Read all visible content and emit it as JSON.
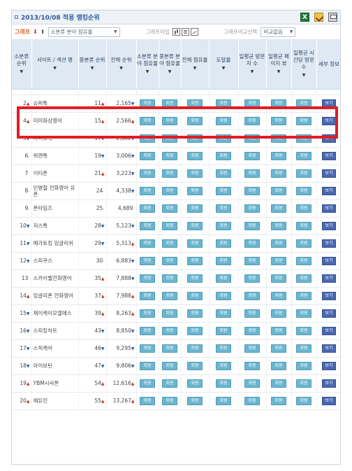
{
  "header": {
    "title": "2013/10/08 적용 랭킹순위"
  },
  "toolbar": {
    "graph_label": "그래프",
    "category_select": "소분류 분야 점유율",
    "graph_type_label": "그래프타입",
    "compare_label": "그래프비교선택",
    "compare_select": "비교없음"
  },
  "columns": [
    {
      "label": "소분류 순위"
    },
    {
      "label": "사이트 / 섹션 명"
    },
    {
      "label": "중분류 순위"
    },
    {
      "label": "전체 순위"
    },
    {
      "label": "소분류 분야 점유율"
    },
    {
      "label": "중분류 분야 점유율"
    },
    {
      "label": "전체 점유율"
    },
    {
      "label": "도달율"
    },
    {
      "label": "일평균 방문자 수"
    },
    {
      "label": "일평균 페이지 뷰"
    },
    {
      "label": "일평균 시간당 방문수"
    },
    {
      "label": "세부 정보"
    }
  ],
  "rows": [
    {
      "rank": "2",
      "rank_change": "up",
      "name": "슈퍼톡",
      "mid_rank": "11",
      "mid_change": "up",
      "total_rank": "2,165",
      "total_change": "down"
    },
    {
      "rank": "4",
      "rank_change": "up",
      "name": "미미화상영어",
      "mid_rank": "15",
      "mid_change": "up",
      "total_rank": "2,566",
      "total_change": "up"
    },
    {
      "rank": "5",
      "rank_change": "down",
      "name": "아이고톡",
      "mid_rank": "17",
      "mid_change": "down",
      "total_rank": "2,682",
      "total_change": "down"
    },
    {
      "rank": "6",
      "rank_change": "same",
      "name": "위캔톡",
      "mid_rank": "19",
      "mid_change": "down",
      "total_rank": "3,006",
      "total_change": "down"
    },
    {
      "rank": "7",
      "rank_change": "same",
      "name": "이티폰",
      "mid_rank": "21",
      "mid_change": "up",
      "total_rank": "3,223",
      "total_change": "down"
    },
    {
      "rank": "8",
      "rank_change": "same",
      "name": "민병철 전화영어 유폰",
      "mid_rank": "24",
      "mid_change": "same",
      "total_rank": "4,338",
      "total_change": "down"
    },
    {
      "rank": "9",
      "rank_change": "same",
      "name": "폰타임즈",
      "mid_rank": "25",
      "mid_change": "same",
      "total_rank": "4,689",
      "total_change": "same"
    },
    {
      "rank": "10",
      "rank_change": "down",
      "name": "저스톡",
      "mid_rank": "28",
      "mid_change": "down",
      "total_rank": "5,123",
      "total_change": "down"
    },
    {
      "rank": "11",
      "rank_change": "down",
      "name": "메가토킹 잉글리쉬",
      "mid_rank": "29",
      "mid_change": "down",
      "total_rank": "5,313",
      "total_change": "up"
    },
    {
      "rank": "12",
      "rank_change": "down",
      "name": "스피쿠스",
      "mid_rank": "30",
      "mid_change": "same",
      "total_rank": "6,883",
      "total_change": "down"
    },
    {
      "rank": "13",
      "rank_change": "same",
      "name": "스카이벨전화영어",
      "mid_rank": "35",
      "mid_change": "up",
      "total_rank": "7,888",
      "total_change": "down"
    },
    {
      "rank": "14",
      "rank_change": "up",
      "name": "잉글리폰 전화영어",
      "mid_rank": "37",
      "mid_change": "up",
      "total_rank": "7,988",
      "total_change": "up"
    },
    {
      "rank": "15",
      "rank_change": "down",
      "name": "제이케이오엘에스",
      "mid_rank": "39",
      "mid_change": "up",
      "total_rank": "8,263",
      "total_change": "up"
    },
    {
      "rank": "16",
      "rank_change": "down",
      "name": "스피킹차트",
      "mid_rank": "43",
      "mid_change": "down",
      "total_rank": "8,850",
      "total_change": "down"
    },
    {
      "rank": "17",
      "rank_change": "down",
      "name": "스픽케어",
      "mid_rank": "46",
      "mid_change": "down",
      "total_rank": "9,295",
      "total_change": "down"
    },
    {
      "rank": "18",
      "rank_change": "down",
      "name": "아이보틴",
      "mid_rank": "47",
      "mid_change": "down",
      "total_rank": "9,806",
      "total_change": "down"
    },
    {
      "rank": "19",
      "rank_change": "up",
      "name": "YBM시사폰",
      "mid_rank": "54",
      "mid_change": "up",
      "total_rank": "12,616",
      "total_change": "up"
    },
    {
      "rank": "20",
      "rank_change": "up",
      "name": "에듀인",
      "mid_rank": "55",
      "mid_change": "up",
      "total_rank": "13,267",
      "total_change": "up"
    }
  ],
  "button_labels": {
    "member": "회원",
    "view": "보기"
  },
  "colors": {
    "highlight": "#e21c24",
    "member_btn": "#6ab5cf",
    "view_btn": "#4a68b0",
    "up": "#c0392b",
    "down": "#2c5aa0"
  }
}
